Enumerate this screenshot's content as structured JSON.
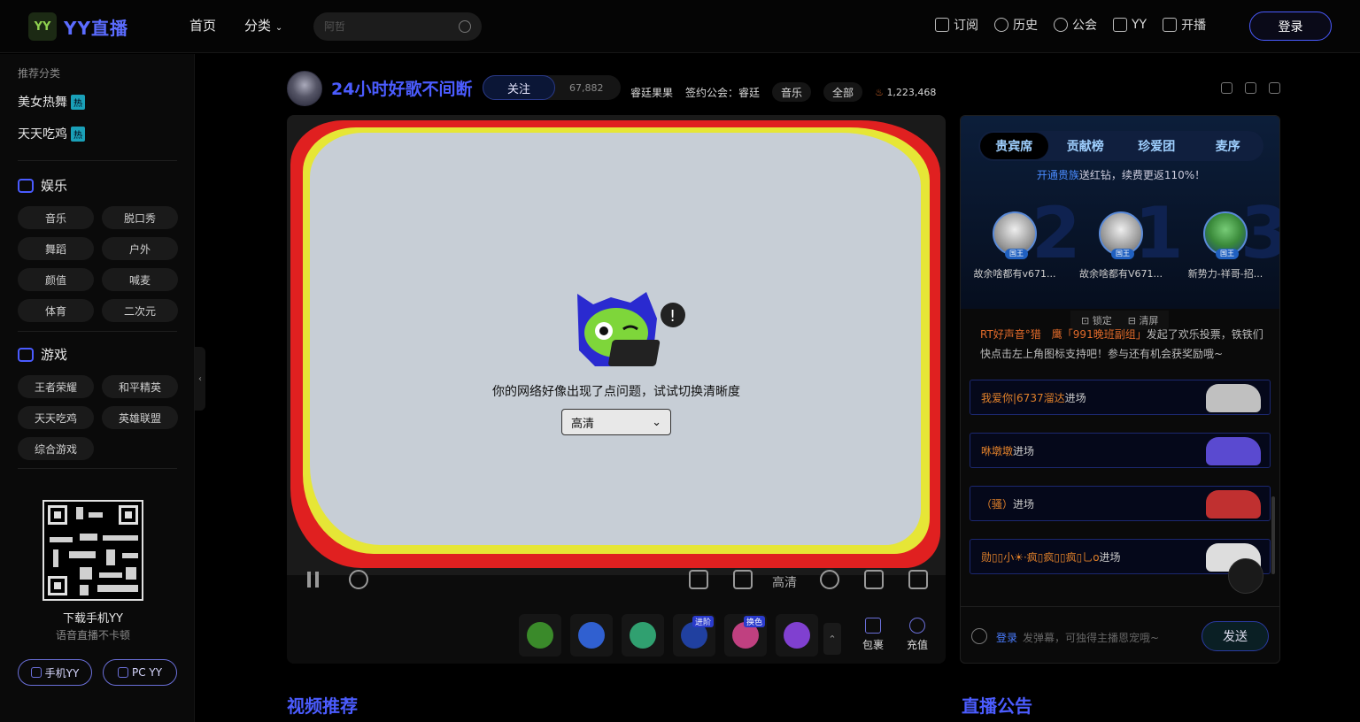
{
  "brand": {
    "logo_mark": "YY",
    "name": "YY直播"
  },
  "nav": {
    "home": "首页",
    "category": "分类"
  },
  "search": {
    "placeholder": "阿哲"
  },
  "top_actions": [
    {
      "label": "订阅",
      "icon": "bookmark-icon"
    },
    {
      "label": "历史",
      "icon": "clock-icon"
    },
    {
      "label": "公会",
      "icon": "guild-icon"
    },
    {
      "label": "YY",
      "icon": "yy-icon"
    },
    {
      "label": "开播",
      "icon": "broadcast-icon"
    }
  ],
  "login_label": "登录",
  "sidebar": {
    "recommend_title": "推荐分类",
    "hot_items": [
      {
        "label": "美女热舞",
        "tag": "热"
      },
      {
        "label": "天天吃鸡",
        "tag": "热"
      }
    ],
    "ent": {
      "title": "娱乐",
      "items": [
        "音乐",
        "脱口秀",
        "舞蹈",
        "户外",
        "颜值",
        "喊麦",
        "体育",
        "二次元"
      ]
    },
    "game": {
      "title": "游戏",
      "items": [
        "王者荣耀",
        "和平精英",
        "天天吃鸡",
        "英雄联盟",
        "综合游戏"
      ]
    },
    "download_title": "下载手机YY",
    "download_sub": "语音直播不卡顿",
    "mobile_btn": "手机YY",
    "pc_btn": "PC YY"
  },
  "room": {
    "title": "24小时好歌不间断",
    "follow_label": "关注",
    "follow_count": "67,882",
    "host": "睿廷果果",
    "guild": "签约公会：睿廷",
    "tag_music": "音乐",
    "tag_all": "全部",
    "heat": "1,223,468"
  },
  "player": {
    "error_msg": "你的网络好像出现了点问题，试试切换清晰度",
    "quality_select": "高清",
    "quality_label": "高清"
  },
  "gifts": [
    {
      "badge": "",
      "color": "#3a8a2a"
    },
    {
      "badge": "",
      "color": "#3060d0"
    },
    {
      "badge": "",
      "color": "#30a070"
    },
    {
      "badge": "进阶",
      "color": "#2040a0"
    },
    {
      "badge": "换色",
      "color": "#c04080"
    },
    {
      "badge": "",
      "color": "#8040d0"
    }
  ],
  "bag_label": "包裹",
  "recharge_label": "充值",
  "panel": {
    "tabs": [
      "贵宾席",
      "贡献榜",
      "珍爱团",
      "麦序"
    ],
    "promo_hl": "开通贵族",
    "promo_rest": "送红钻，续费更返110%！",
    "ranks": [
      {
        "num": "2",
        "name": "故余啥都有v671...",
        "tag": "国王"
      },
      {
        "num": "1",
        "name": "故余啥都有V671...",
        "tag": "国王"
      },
      {
        "num": "3",
        "name": "新势力-祥哥-招...",
        "tag": "国王"
      }
    ],
    "lock": "锁定",
    "clear": "清屏",
    "sys_name": "RT好声音°猎　鹰「991晚班副组」",
    "sys_msg": "发起了欢乐投票，铁铁们快点击左上角图标支持吧！参与还有机会获奖励哦~",
    "chats": [
      {
        "name": "我爱你|6737溜达",
        "action": "进场",
        "car": "#c0c0c0"
      },
      {
        "name": "咻墩墩",
        "action": "进场",
        "car": "#5a4ad0"
      },
      {
        "name": "（骚）",
        "action": "进场",
        "car": "#c03030"
      },
      {
        "name": "勋▯▯小☀·疯▯疯▯▯疯▯乚о",
        "action": "进场",
        "car": "#dddddd"
      }
    ],
    "input_login": "登录",
    "input_placeholder": "发弹幕，可独得主播恩宠哦~",
    "send_label": "发送"
  },
  "sections": {
    "video_rec": "视频推荐",
    "notice": "直播公告"
  }
}
